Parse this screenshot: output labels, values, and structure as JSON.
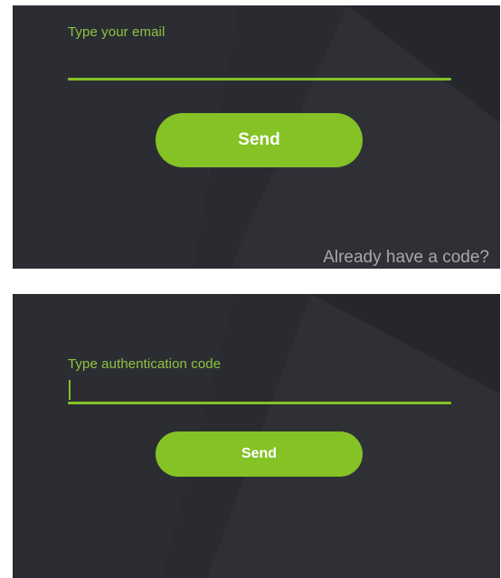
{
  "colors": {
    "panel_bg": "#2c2d33",
    "panel_shade": "#26272d",
    "panel_light": "#33343a",
    "accent_green": "#84c226",
    "label_green": "#8cc63f",
    "link_gray": "#a7a8ad",
    "button_text": "#ffffff"
  },
  "email_screen": {
    "field_label": "Type your email",
    "field_value": "",
    "send_label": "Send",
    "link_label": "Already have a code?"
  },
  "code_screen": {
    "field_label": "Type authentication code",
    "field_value": "",
    "send_label": "Send"
  },
  "icons": {
    "text_caret": "text-cursor-icon"
  }
}
